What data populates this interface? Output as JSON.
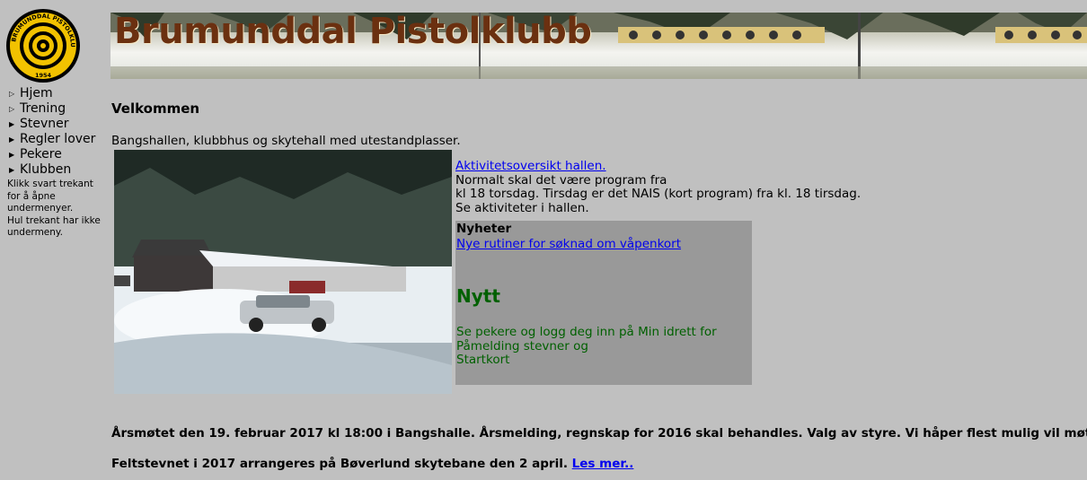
{
  "logo": {
    "ring_text": "BRUMUNDDAL PISTOLKLUBB",
    "year": "1954",
    "colors": {
      "ring": "#000000",
      "gold": "#f2c200"
    }
  },
  "banner": {
    "title": "Brumunddal Pistolklubb"
  },
  "nav": {
    "items": [
      {
        "label": "Hjem",
        "icon": "hollow-triangle-icon"
      },
      {
        "label": "Trening",
        "icon": "hollow-triangle-icon"
      },
      {
        "label": "Stevner",
        "icon": "solid-triangle-icon"
      },
      {
        "label": "Regler lover",
        "icon": "solid-triangle-icon"
      },
      {
        "label": "Pekere",
        "icon": "solid-triangle-icon"
      },
      {
        "label": "Klubben",
        "icon": "solid-triangle-icon"
      }
    ],
    "help": [
      "Klikk svart trekant",
      "for å åpne",
      "undermenyer.",
      "Hul trekant har ikke",
      "undermeny."
    ]
  },
  "main": {
    "heading": "Velkommen",
    "intro": "Bangshallen, klubbhus og skytehall med utestandplasser.",
    "info": {
      "link": "Aktivitetsoversikt hallen.",
      "lines": [
        "Normalt skal det være program fra",
        "kl 18 torsdag. Tirsdag er det NAIS (kort program) fra kl. 18 tirsdag.",
        "Se aktiviteter i hallen."
      ]
    },
    "news": {
      "heading": "Nyheter",
      "link": "Nye rutiner for søknad om våpenkort",
      "nytt": "Nytt",
      "lines": [
        "Se pekere og logg deg inn på Min idrett for",
        "Påmelding stevner og",
        "Startkort"
      ]
    },
    "announcement1": "Årsmøtet den 19. februar 2017 kl 18:00 i Bangshalle. Årsmelding, regnskap for 2016 skal behandles. Valg av styre. Vi håper flest mulig vil møte opp.",
    "announcement2": "Feltstevnet i 2017 arrangeres på Bøverlund skytebane den 2 april.",
    "read_more": "Les mer.."
  },
  "colors": {
    "page_bg": "#c0c0c0",
    "link": "#0000ee",
    "news_bg": "#999999",
    "nytt_green": "#006000"
  }
}
